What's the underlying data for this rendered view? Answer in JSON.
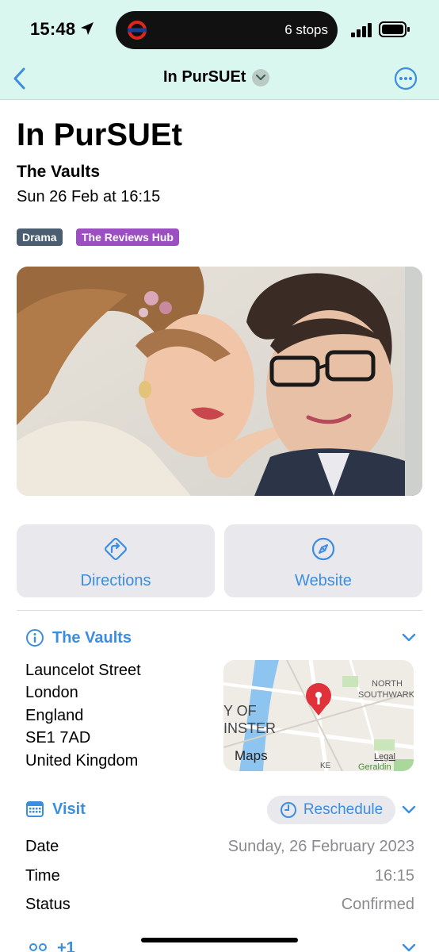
{
  "status_bar": {
    "time": "15:48",
    "live_activity": "6 stops"
  },
  "nav": {
    "title": "In PurSUEt"
  },
  "event": {
    "title": "In PurSUEt",
    "venue": "The Vaults",
    "datetime": "Sun 26 Feb at 16:15",
    "tags": [
      "Drama",
      "The Reviews Hub"
    ]
  },
  "actions": {
    "directions": "Directions",
    "website": "Website"
  },
  "location": {
    "title": "The Vaults",
    "address": [
      "Launcelot Street",
      "London",
      "England",
      "SE1 7AD",
      "United Kingdom"
    ],
    "map": {
      "brand": "Maps",
      "legal": "Legal",
      "labels": [
        "NORTH",
        "SOUTHWARK",
        "Y OF",
        "INSTER",
        "Geraldin",
        "KE"
      ]
    }
  },
  "visit": {
    "title": "Visit",
    "reschedule": "Reschedule",
    "rows": [
      {
        "label": "Date",
        "value": "Sunday, 26 February 2023"
      },
      {
        "label": "Time",
        "value": "16:15"
      },
      {
        "label": "Status",
        "value": "Confirmed"
      }
    ]
  },
  "people": {
    "title": "+1"
  },
  "colors": {
    "accent": "#3b8de0",
    "header_bg": "#d9f7ee",
    "tag_drama": "#4a5d71",
    "tag_hub": "#9b4fc1"
  }
}
